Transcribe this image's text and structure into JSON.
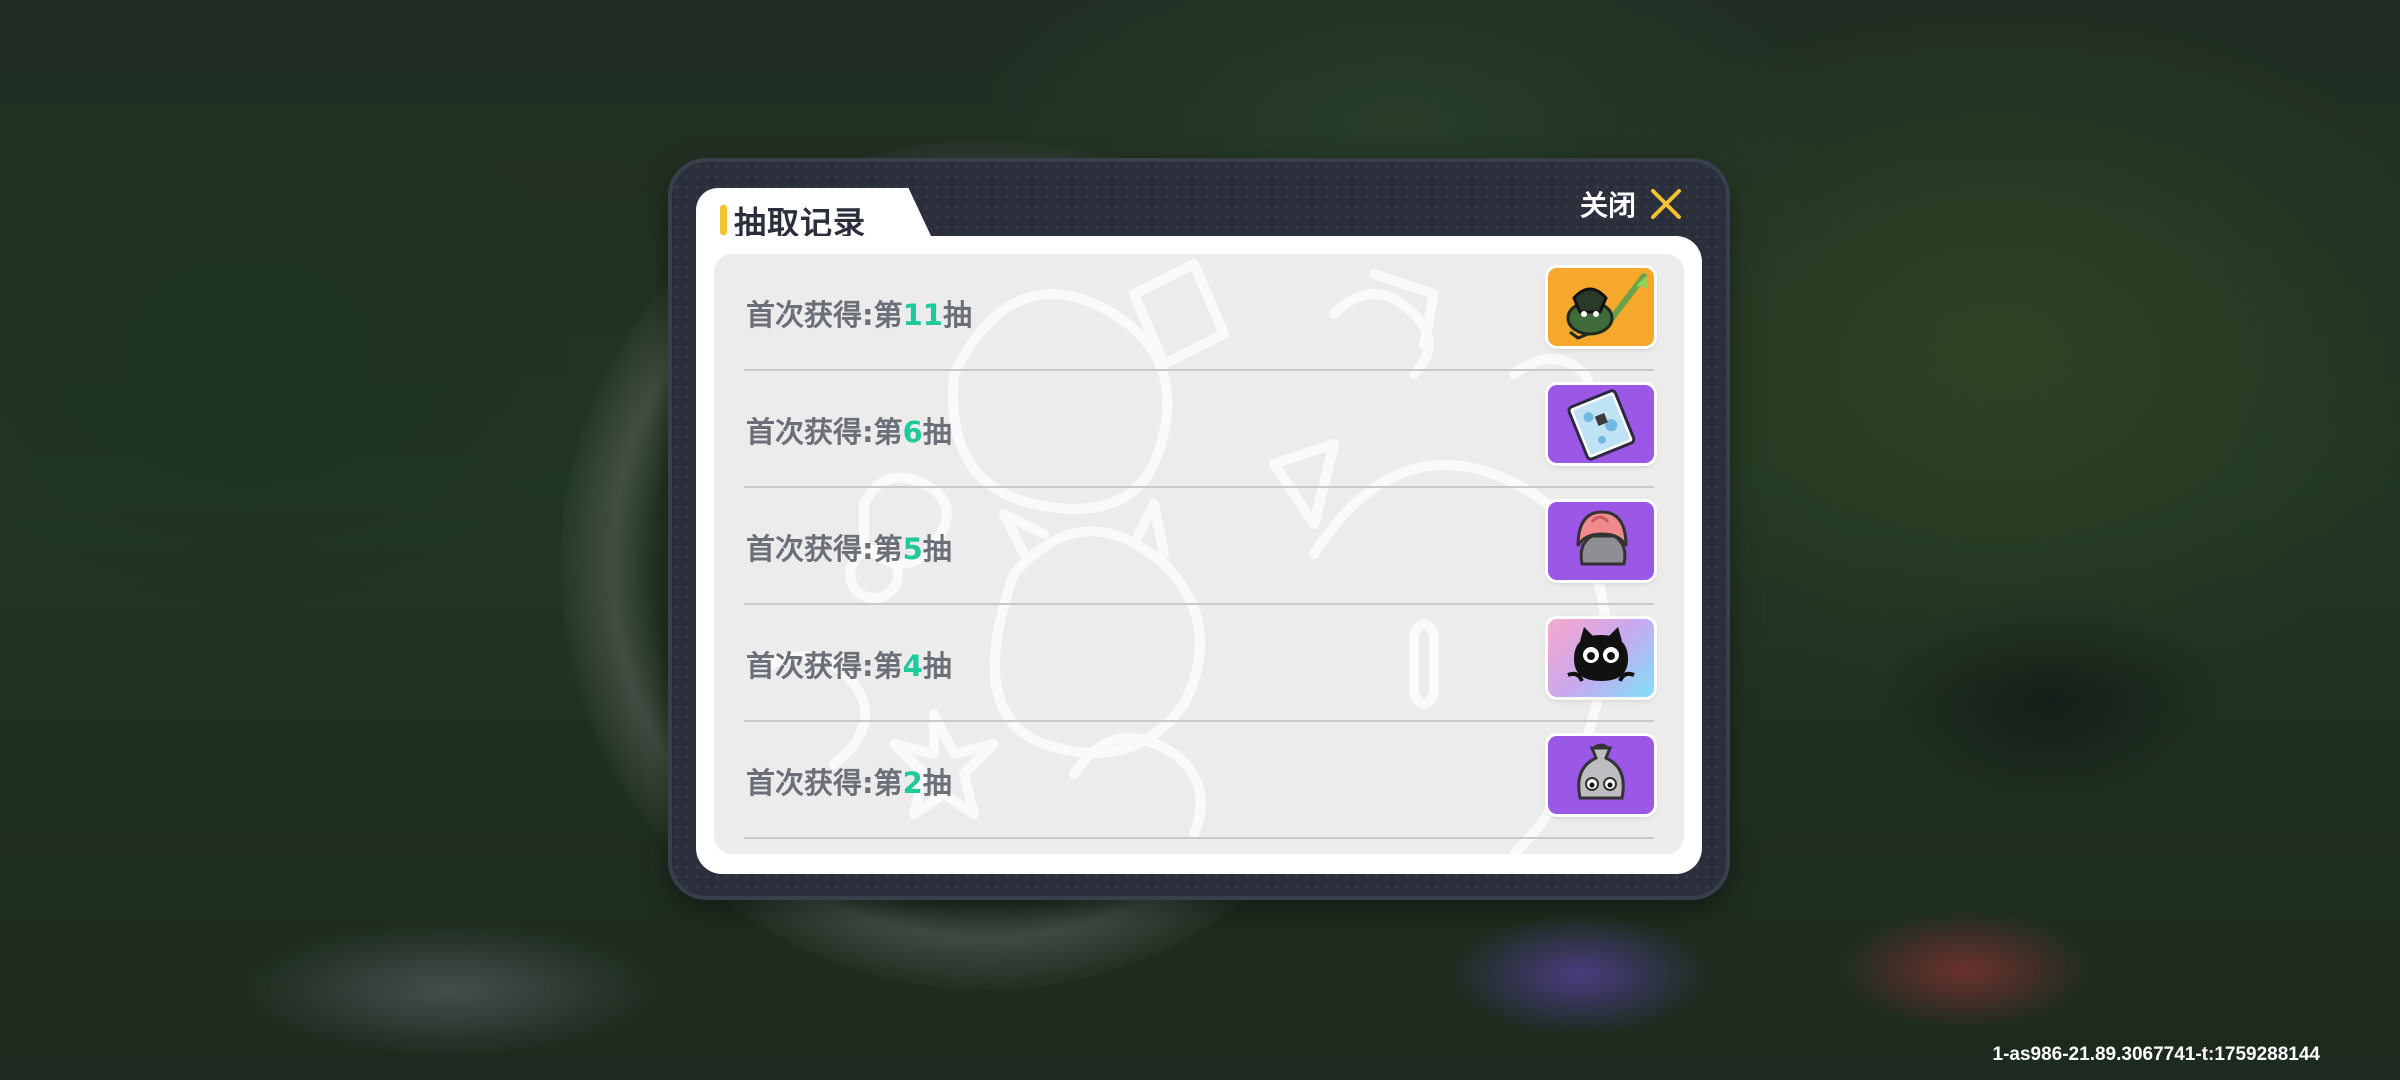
{
  "dialog": {
    "title": "抽取记录",
    "close_label": "关闭"
  },
  "records": [
    {
      "prefix": "首次获得:第",
      "number": "11",
      "suffix": "抽",
      "rarity_color": "#f6a82c",
      "item_icon": "broom-dragon-icon"
    },
    {
      "prefix": "首次获得:第",
      "number": "6",
      "suffix": "抽",
      "rarity_color": "#9b57e6",
      "item_icon": "map-card-icon"
    },
    {
      "prefix": "首次获得:第",
      "number": "5",
      "suffix": "抽",
      "rarity_color": "#9b57e6",
      "item_icon": "pink-hair-icon"
    },
    {
      "prefix": "首次获得:第",
      "number": "4",
      "suffix": "抽",
      "rarity_color": "gradient-rainbow",
      "item_icon": "black-cat-icon"
    },
    {
      "prefix": "首次获得:第",
      "number": "2",
      "suffix": "抽",
      "rarity_color": "#9b57e6",
      "item_icon": "sack-creature-icon"
    }
  ],
  "colors": {
    "accent_yellow": "#f2c230",
    "number_green": "#20c99c",
    "dialog_dark": "#2b2f3b"
  },
  "footer": {
    "build_id": "1-as986-21.89.3067741-t:1759288144"
  }
}
